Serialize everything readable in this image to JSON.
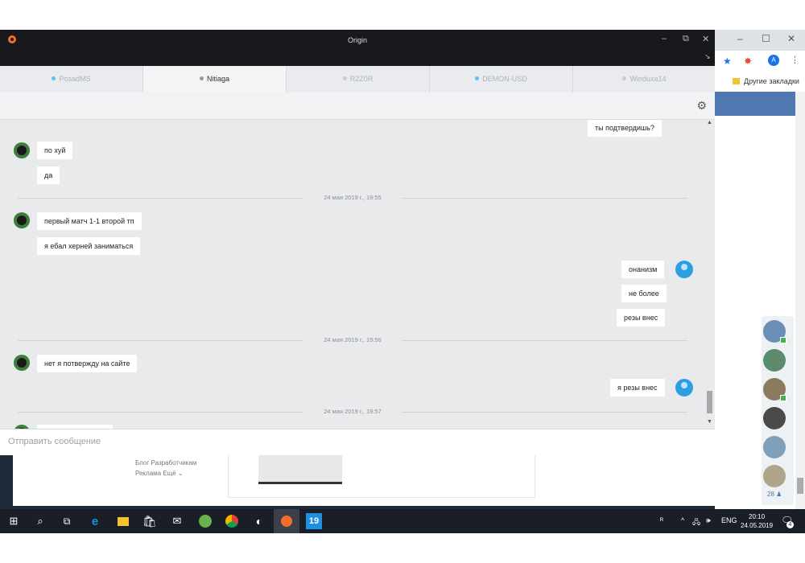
{
  "origin": {
    "title": "Origin",
    "tabs": [
      {
        "label": "PosadMS",
        "dot_color": "#5bc0f0"
      },
      {
        "label": "Nitiaga",
        "dot_color": "#999999"
      },
      {
        "label": "R2Z0R",
        "dot_color": "#cccccc"
      },
      {
        "label": "DEMON-USD",
        "dot_color": "#5bc0f0"
      },
      {
        "label": "Winduxa14",
        "dot_color": "#cccccc"
      }
    ],
    "active_tab": "Nitiaga",
    "messages": {
      "m0": "ты подтвердишь?",
      "m1": "по хуй",
      "m2": "да",
      "ts1": "24 мая 2019 г., 19:55",
      "m3": "первый матч 1-1 второй тп",
      "m4": "я ебал херней заниматься",
      "m5": "онанизм",
      "m6": "не более",
      "m7": "резы внес",
      "ts2": "24 мая 2019 г., 19:56",
      "m8": "нет я потвержду на сайте",
      "m9": "я резы внес",
      "ts3": "24 мая 2019 г., 19:57"
    },
    "composer": {
      "placeholder": "Отправить сообщение"
    }
  },
  "chrome": {
    "bookmarks_label": "Другие закладки",
    "profile_letter": "A",
    "friends_count": "28"
  },
  "background_page": {
    "links_row1": "Блог  Разработчикам",
    "links_row2": "Реклама  Ещё ⌄"
  },
  "taskbar": {
    "lang": "ENG",
    "time": "20:10",
    "date": "24.05.2019",
    "notifications": "4",
    "badge_19": "19"
  },
  "colors": {
    "origin_orange": "#f56c2d",
    "self_avatar": "#2d9fe0",
    "titlebar": "#17191c"
  }
}
